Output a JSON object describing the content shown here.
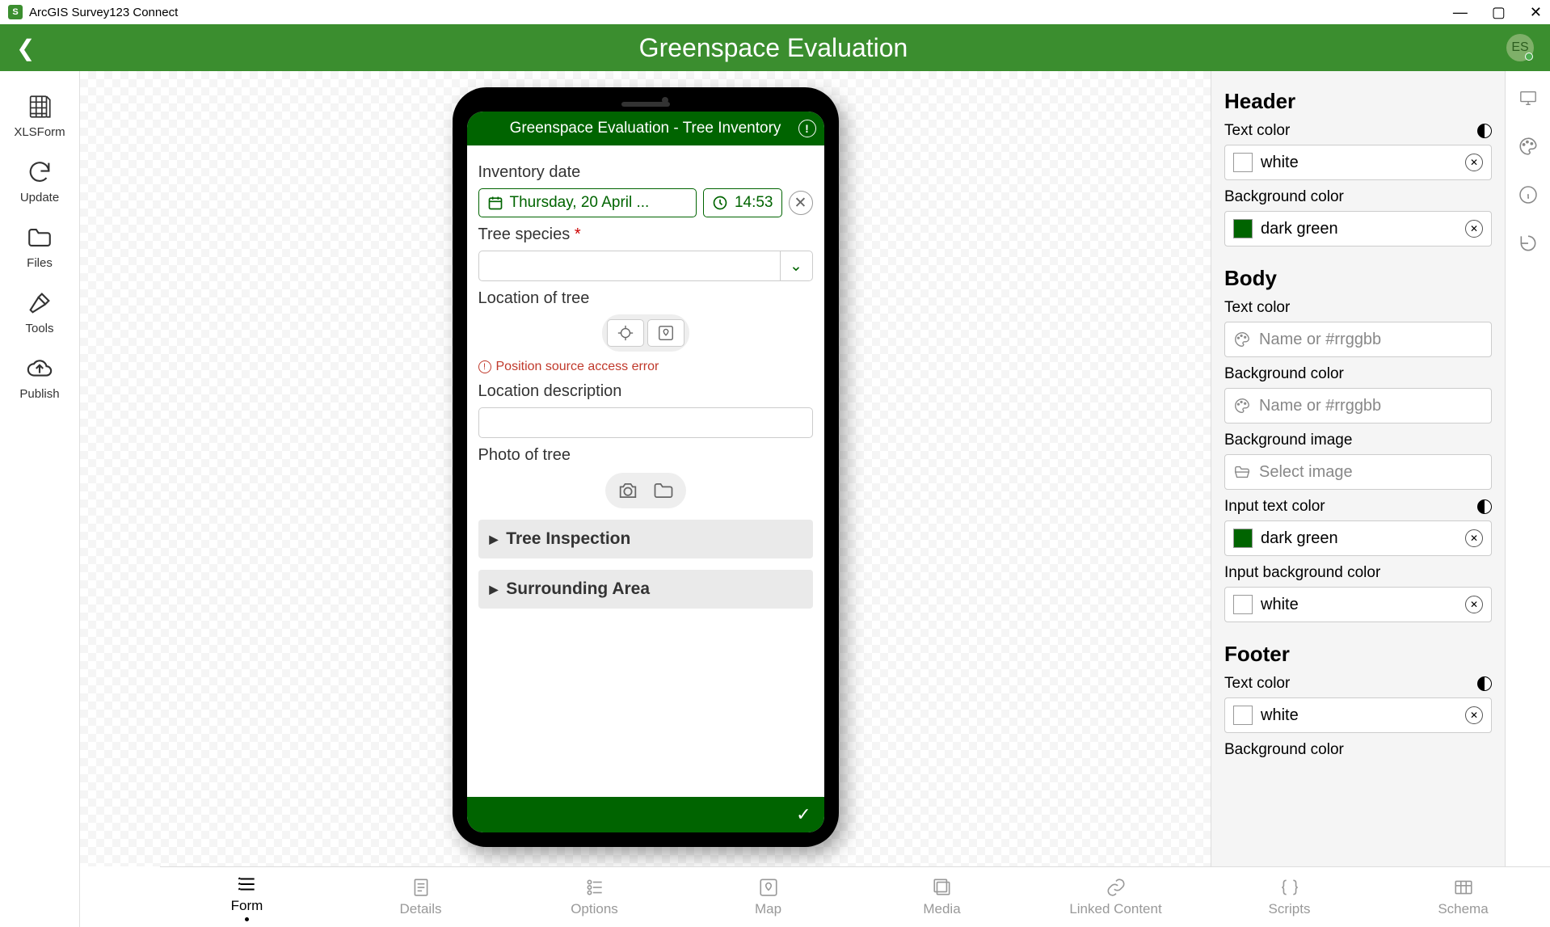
{
  "titlebar": {
    "app_name": "ArcGIS Survey123 Connect"
  },
  "header": {
    "title": "Greenspace Evaluation",
    "avatar_initials": "ES"
  },
  "left_sidebar": {
    "items": [
      {
        "label": "XLSForm"
      },
      {
        "label": "Update"
      },
      {
        "label": "Files"
      },
      {
        "label": "Tools"
      },
      {
        "label": "Publish"
      }
    ]
  },
  "form": {
    "header_title": "Greenspace Evaluation - Tree Inventory",
    "fields": {
      "inventory_date": {
        "label": "Inventory date",
        "date_value": "Thursday, 20 April ...",
        "time_value": "14:53"
      },
      "tree_species": {
        "label": "Tree species"
      },
      "location_of_tree": {
        "label": "Location of tree",
        "error": "Position source access error"
      },
      "location_description": {
        "label": "Location description"
      },
      "photo_of_tree": {
        "label": "Photo of tree"
      }
    },
    "sections": [
      {
        "title": "Tree Inspection"
      },
      {
        "title": "Surrounding Area"
      }
    ]
  },
  "right_panel": {
    "header_section": {
      "title": "Header",
      "text_color": {
        "label": "Text color",
        "value": "white",
        "swatch": "#ffffff"
      },
      "background_color": {
        "label": "Background color",
        "value": "dark green",
        "swatch": "#006400"
      }
    },
    "body_section": {
      "title": "Body",
      "text_color": {
        "label": "Text color",
        "placeholder": "Name or #rrggbb"
      },
      "background_color": {
        "label": "Background color",
        "placeholder": "Name or #rrggbb"
      },
      "background_image": {
        "label": "Background image",
        "placeholder": "Select image"
      },
      "input_text_color": {
        "label": "Input text color",
        "value": "dark green",
        "swatch": "#006400"
      },
      "input_background_color": {
        "label": "Input background color",
        "value": "white",
        "swatch": "#ffffff"
      }
    },
    "footer_section": {
      "title": "Footer",
      "text_color": {
        "label": "Text color",
        "value": "white",
        "swatch": "#ffffff"
      },
      "background_color": {
        "label": "Background color"
      }
    }
  },
  "bottom_tabs": {
    "items": [
      {
        "label": "Form"
      },
      {
        "label": "Details"
      },
      {
        "label": "Options"
      },
      {
        "label": "Map"
      },
      {
        "label": "Media"
      },
      {
        "label": "Linked Content"
      },
      {
        "label": "Scripts"
      },
      {
        "label": "Schema"
      }
    ]
  }
}
